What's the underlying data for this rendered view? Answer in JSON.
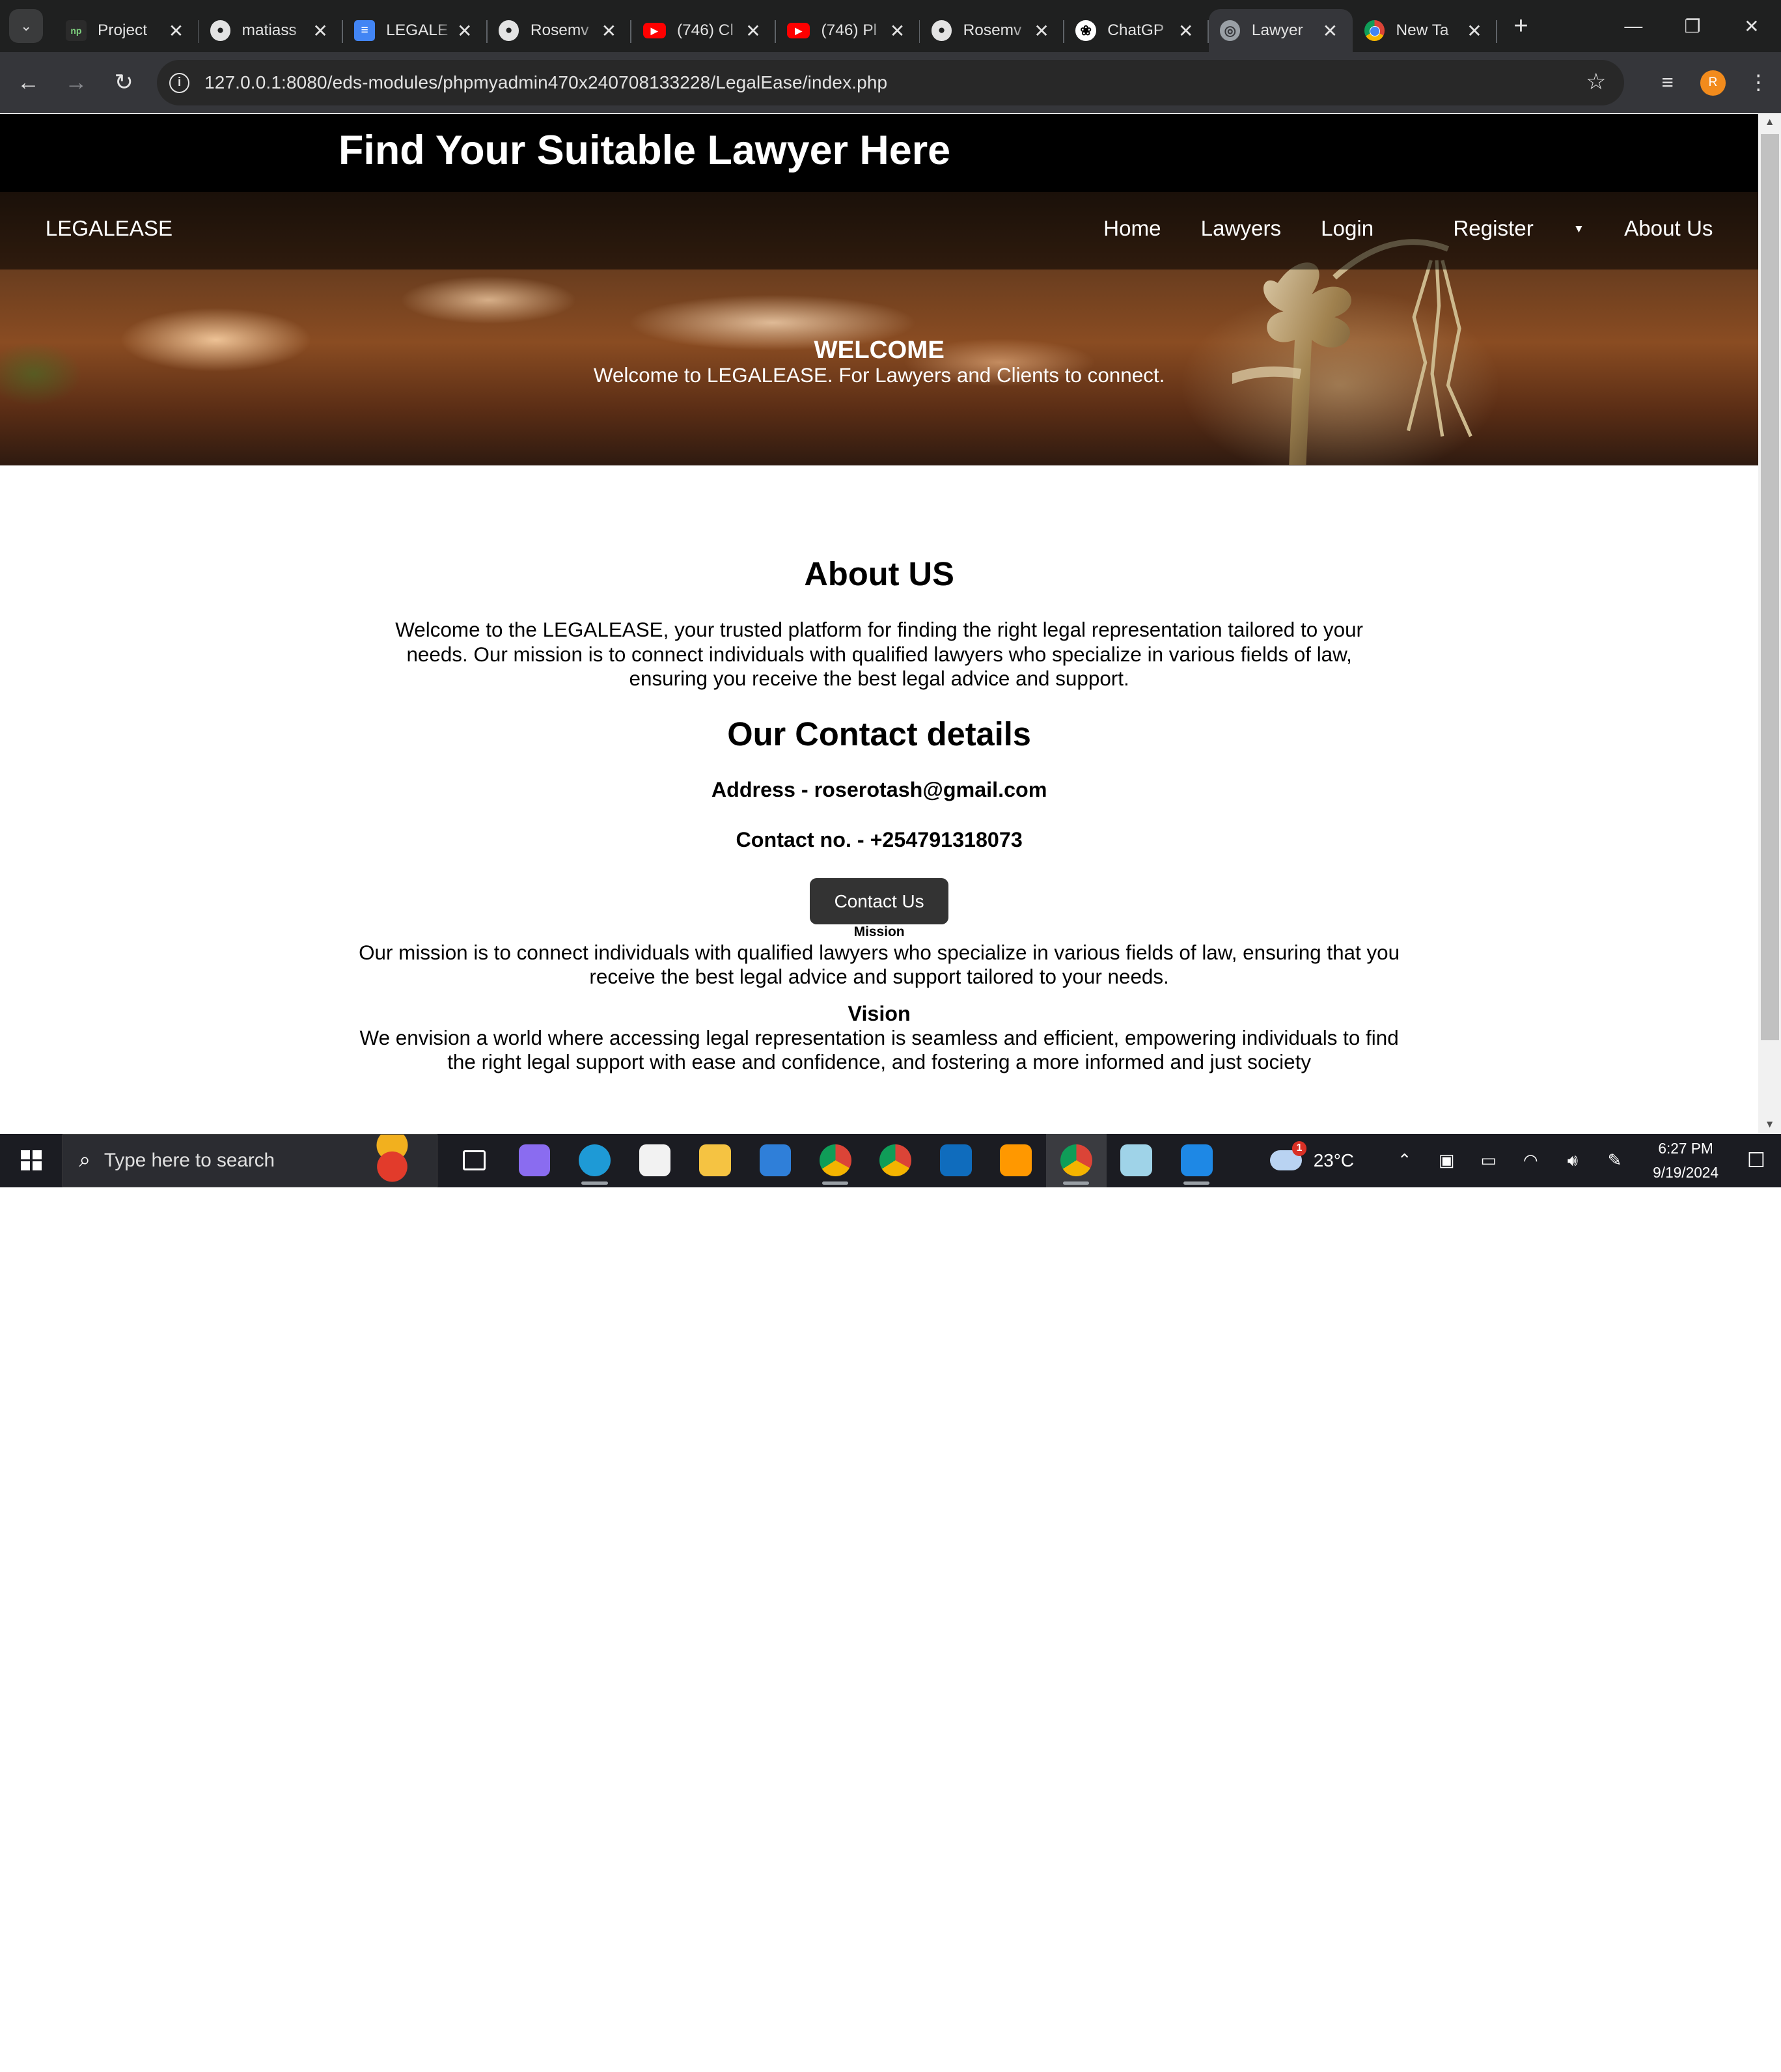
{
  "browser": {
    "tabs": [
      {
        "icon": "project-favicon-icon",
        "title": "Project"
      },
      {
        "icon": "github-icon",
        "title": "matiass"
      },
      {
        "icon": "google-docs-icon",
        "title": "LEGALE"
      },
      {
        "icon": "github-icon",
        "title": "Rosemv"
      },
      {
        "icon": "youtube-icon",
        "title": "(746) Cl"
      },
      {
        "icon": "youtube-icon",
        "title": "(746) Pl"
      },
      {
        "icon": "github-icon",
        "title": "Rosemv"
      },
      {
        "icon": "chatgpt-icon",
        "title": "ChatGP"
      },
      {
        "icon": "globe-icon",
        "title": "Lawyer"
      },
      {
        "icon": "chrome-icon",
        "title": "New Ta"
      }
    ],
    "active_tab_index": 8,
    "url": "127.0.0.1:8080/eds-modules/phpmyadmin470x240708133228/LegalEase/index.php",
    "profile_initial": "R"
  },
  "site": {
    "header_title": "Find Your Suitable Lawyer Here",
    "brand": "LEGALEASE",
    "nav": {
      "home": "Home",
      "lawyers": "Lawyers",
      "login": "Login",
      "register": "Register",
      "about": "About Us"
    },
    "hero": {
      "title": "WELCOME",
      "subtitle": "Welcome to LEGALEASE. For Lawyers and Clients to connect."
    },
    "about": {
      "heading": "About US",
      "text": "Welcome to the LEGALEASE, your trusted platform for finding the right legal representation tailored to your needs. Our mission is to connect individuals with qualified lawyers who specialize in various fields of law, ensuring you receive the best legal advice and support."
    },
    "contact": {
      "heading": "Our Contact details",
      "address": "Address - roserotash@gmail.com",
      "phone": "Contact no. - +254791318073",
      "button": "Contact Us"
    },
    "mission": {
      "heading": "Mission",
      "text": "Our mission is to connect individuals with qualified lawyers who specialize in various fields of law, ensuring that you receive the best legal advice and support tailored to your needs."
    },
    "vision": {
      "heading": "Vision",
      "text": "We envision a world where accessing legal representation is seamless and efficient, empowering individuals to find the right legal support with ease and confidence, and fostering a more informed and just society"
    }
  },
  "taskbar": {
    "search_placeholder": "Type here to search",
    "apps": [
      {
        "name": "task-view-icon",
        "color": "#1b1c22"
      },
      {
        "name": "copilot-icon",
        "color": "#8a6cf0"
      },
      {
        "name": "edge-icon",
        "color": "#1e9ad6"
      },
      {
        "name": "microsoft-store-icon",
        "color": "#f2f2f2"
      },
      {
        "name": "file-explorer-icon",
        "color": "#f5c342"
      },
      {
        "name": "mail-icon",
        "color": "#2f7fd9"
      },
      {
        "name": "chrome-icon",
        "color": "#db4437"
      },
      {
        "name": "chrome-beta-icon",
        "color": "#f4b400"
      },
      {
        "name": "outlook-icon",
        "color": "#0f6cbd"
      },
      {
        "name": "sublime-text-icon",
        "color": "#ff9800"
      },
      {
        "name": "chrome-profile-icon",
        "color": "#db4437"
      },
      {
        "name": "notepad-icon",
        "color": "#9fd3e8"
      },
      {
        "name": "vscode-icon",
        "color": "#1e88e5"
      }
    ],
    "weather_temp": "23°C",
    "weather_badge": "1",
    "time": "6:27 PM",
    "date": "9/19/2024"
  }
}
